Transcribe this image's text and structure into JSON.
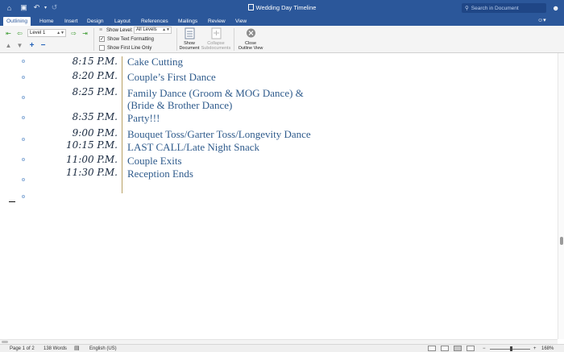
{
  "window": {
    "title": "Wedding Day Timeline",
    "search_placeholder": "Search in Document"
  },
  "ribbon_tabs": [
    "Outlining",
    "Home",
    "Insert",
    "Design",
    "Layout",
    "References",
    "Mailings",
    "Review",
    "View"
  ],
  "active_tab": "Outlining",
  "outline_tools": {
    "level_value": "Level 1",
    "show_level_label": "Show Level:",
    "show_level_value": "All Levels",
    "show_text_formatting_label": "Show Text Formatting",
    "show_text_formatting_checked": true,
    "show_first_line_only_label": "Show First Line Only",
    "show_first_line_only_checked": false,
    "show_document_label": "Show\nDocument",
    "collapse_subdocuments_label": "Collapse\nSubdocuments",
    "close_outline_view_label": "Close\nOutline View"
  },
  "timeline": [
    {
      "time": "8:15 P.M.",
      "event": "Cake Cutting"
    },
    {
      "time": "8:20 P.M.",
      "event": "Couple’s First Dance"
    },
    {
      "time": "8:25 P.M.",
      "event": "Family Dance (Groom & MOG Dance) & (Bride & Brother Dance)"
    },
    {
      "time": "8:35 P.M.",
      "event": "Party!!!"
    },
    {
      "time": "9:00 P.M.",
      "event": "Bouquet Toss/Garter Toss/Longevity Dance"
    },
    {
      "time": "10:15 P.M.",
      "event": "LAST CALL/Late Night Snack"
    },
    {
      "time": "11:00 P.M.",
      "event": "Couple Exits"
    },
    {
      "time": "11:30 P.M.",
      "event": "Reception Ends"
    }
  ],
  "status": {
    "page": "Page 1 of 2",
    "words": "138 Words",
    "language": "English (US)",
    "zoom": "168%"
  },
  "colors": {
    "ribbon_blue": "#2b579a",
    "event_text": "#2f5b8c",
    "time_text": "#1a2a40"
  }
}
